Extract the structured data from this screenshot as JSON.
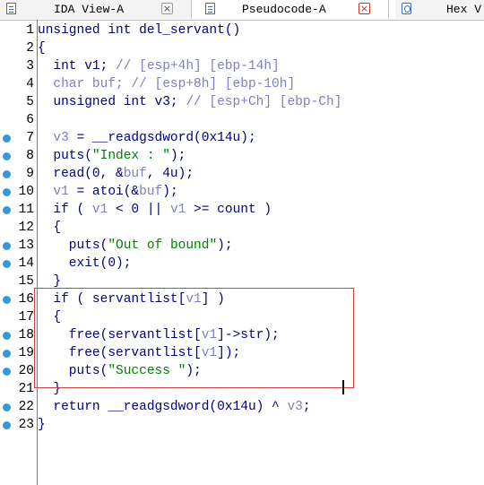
{
  "tabs": [
    {
      "label": "IDA View-A",
      "close": "×",
      "icon": "document-icon"
    },
    {
      "label": "Pseudocode-A",
      "close": "×",
      "icon": "document-icon"
    },
    {
      "label": "Hex V",
      "icon": "hex-view-icon"
    }
  ],
  "colors": {
    "keyword": "#00007f",
    "variable": "#7f7fbf",
    "string": "#007f00",
    "breakpoint_dot": "#3399dd",
    "highlight_box": "#d04040"
  },
  "lines": [
    {
      "num": "1",
      "dot": false,
      "parts": [
        [
          "kw",
          "unsigned int del_servant()"
        ]
      ]
    },
    {
      "num": "2",
      "dot": false,
      "parts": [
        [
          "kw",
          "{"
        ]
      ]
    },
    {
      "num": "3",
      "dot": false,
      "parts": [
        [
          "kw",
          "  int v1; "
        ],
        [
          "com",
          "// [esp+4h] [ebp-14h]"
        ]
      ]
    },
    {
      "num": "4",
      "dot": false,
      "parts": [
        [
          "com",
          "  char buf; // [esp+8h] [ebp-10h]"
        ]
      ]
    },
    {
      "num": "5",
      "dot": false,
      "parts": [
        [
          "kw",
          "  unsigned int v3; "
        ],
        [
          "com",
          "// [esp+Ch] [ebp-Ch]"
        ]
      ]
    },
    {
      "num": "6",
      "dot": false,
      "parts": [
        [
          "kw",
          ""
        ]
      ]
    },
    {
      "num": "7",
      "dot": true,
      "parts": [
        [
          "var",
          "  v3"
        ],
        [
          "kw",
          " = __readgsdword(0x14u);"
        ]
      ]
    },
    {
      "num": "8",
      "dot": true,
      "parts": [
        [
          "kw",
          "  puts("
        ],
        [
          "str",
          "\"Index : \""
        ],
        [
          "kw",
          ");"
        ]
      ]
    },
    {
      "num": "9",
      "dot": true,
      "parts": [
        [
          "kw",
          "  read(0, &"
        ],
        [
          "var",
          "buf"
        ],
        [
          "kw",
          ", 4u);"
        ]
      ]
    },
    {
      "num": "10",
      "dot": true,
      "parts": [
        [
          "var",
          "  v1"
        ],
        [
          "kw",
          " = atoi(&"
        ],
        [
          "var",
          "buf"
        ],
        [
          "kw",
          ");"
        ]
      ]
    },
    {
      "num": "11",
      "dot": true,
      "parts": [
        [
          "kw",
          "  if ( "
        ],
        [
          "var",
          "v1"
        ],
        [
          "kw",
          " < 0 || "
        ],
        [
          "var",
          "v1"
        ],
        [
          "kw",
          " >= count )"
        ]
      ]
    },
    {
      "num": "12",
      "dot": false,
      "parts": [
        [
          "kw",
          "  {"
        ]
      ]
    },
    {
      "num": "13",
      "dot": true,
      "parts": [
        [
          "kw",
          "    puts("
        ],
        [
          "str",
          "\"Out of bound\""
        ],
        [
          "kw",
          ");"
        ]
      ]
    },
    {
      "num": "14",
      "dot": true,
      "parts": [
        [
          "kw",
          "    exit(0);"
        ]
      ]
    },
    {
      "num": "15",
      "dot": false,
      "parts": [
        [
          "kw",
          "  }"
        ]
      ]
    },
    {
      "num": "16",
      "dot": true,
      "parts": [
        [
          "kw",
          "  if ( servantlist["
        ],
        [
          "var",
          "v1"
        ],
        [
          "kw",
          "] )"
        ]
      ]
    },
    {
      "num": "17",
      "dot": false,
      "parts": [
        [
          "kw",
          "  {"
        ]
      ]
    },
    {
      "num": "18",
      "dot": true,
      "parts": [
        [
          "kw",
          "    free(servantlist["
        ],
        [
          "var",
          "v1"
        ],
        [
          "kw",
          "]->str);"
        ]
      ]
    },
    {
      "num": "19",
      "dot": true,
      "parts": [
        [
          "kw",
          "    free(servantlist["
        ],
        [
          "var",
          "v1"
        ],
        [
          "kw",
          "]);"
        ]
      ]
    },
    {
      "num": "20",
      "dot": true,
      "parts": [
        [
          "kw",
          "    puts("
        ],
        [
          "str",
          "\"Success \""
        ],
        [
          "kw",
          ");"
        ]
      ]
    },
    {
      "num": "21",
      "dot": false,
      "parts": [
        [
          "kw",
          "  }"
        ]
      ]
    },
    {
      "num": "22",
      "dot": true,
      "parts": [
        [
          "kw",
          "  return __readgsdword(0x14u) ^ "
        ],
        [
          "var",
          "v3"
        ],
        [
          "kw",
          ";"
        ]
      ]
    },
    {
      "num": "23",
      "dot": true,
      "parts": [
        [
          "kw",
          "}"
        ]
      ]
    }
  ]
}
